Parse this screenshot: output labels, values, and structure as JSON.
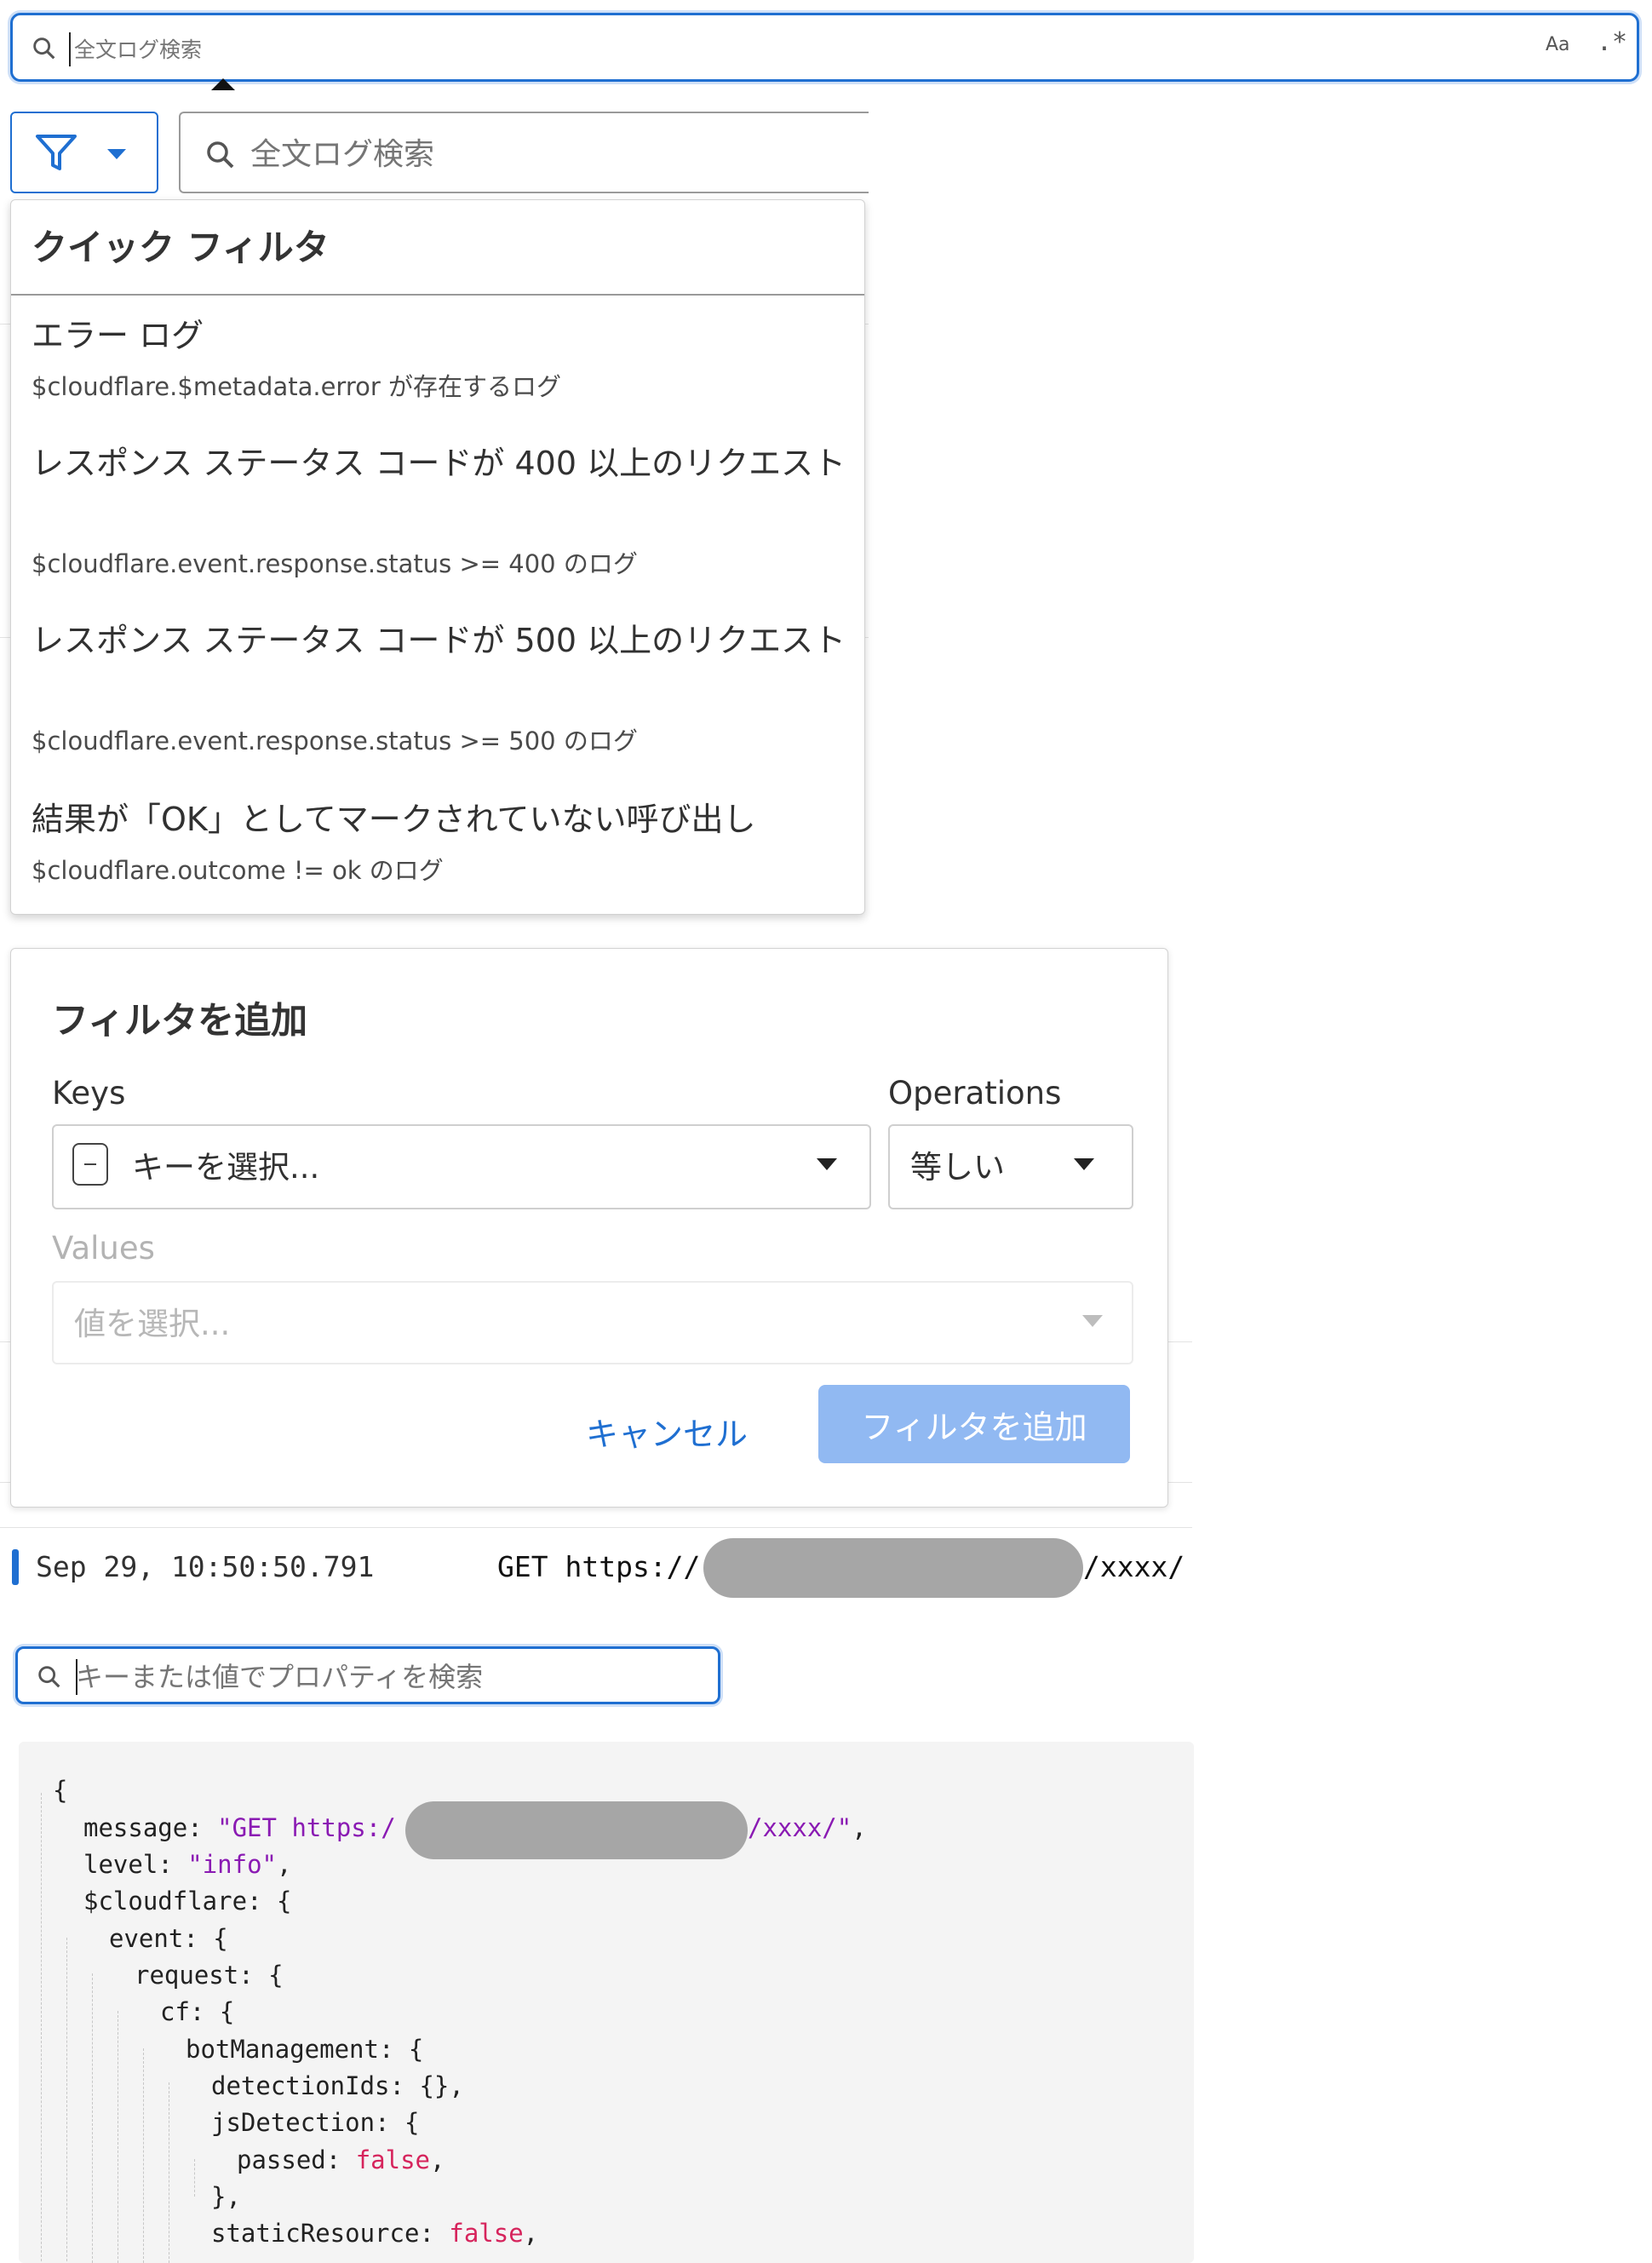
{
  "top_search": {
    "placeholder": "全文ログ検索",
    "case_toggle": "Aa",
    "regex_toggle": ".*"
  },
  "filter_bar": {
    "search_placeholder": "全文ログ検索"
  },
  "quick_filter": {
    "header": "クイック フィルタ",
    "items": [
      {
        "title": "エラー ログ",
        "desc": "$cloudflare.$metadata.error が存在するログ"
      },
      {
        "title": "レスポンス ステータス コードが 400 以上のリクエスト",
        "desc": "$cloudflare.event.response.status >= 400 のログ"
      },
      {
        "title": "レスポンス ステータス コードが 500 以上のリクエスト",
        "desc": "$cloudflare.event.response.status >= 500 のログ"
      },
      {
        "title": "結果が「OK」としてマークされていない呼び出し",
        "desc": "$cloudflare.outcome != ok のログ"
      }
    ]
  },
  "add_filter": {
    "title": "フィルタを追加",
    "keys_label": "Keys",
    "keys_placeholder": "キーを選択...",
    "operations_label": "Operations",
    "operation_value": "等しい",
    "values_label": "Values",
    "values_placeholder": "値を選択...",
    "cancel_label": "キャンセル",
    "submit_label": "フィルタを追加"
  },
  "log_row": {
    "timestamp": "Sep 29, 10:50:50.791",
    "request_prefix": "GET https://",
    "request_suffix": "/xxxx/"
  },
  "property_search": {
    "placeholder": "キーまたは値でプロパティを検索"
  },
  "json_view": {
    "open": "{",
    "message_key": "message",
    "message_prefix": "\"GET https:/",
    "message_suffix": "/xxxx/\"",
    "level_key": "level",
    "level_value": "\"info\"",
    "cloudflare_key": "$cloudflare",
    "event_key": "event",
    "request_key": "request",
    "cf_key": "cf",
    "bot_key": "botManagement",
    "detection_key": "detectionIds",
    "detection_value": "{}",
    "js_key": "jsDetection",
    "passed_key": "passed",
    "passed_value": "false",
    "close_inner": "},",
    "static_key": "staticResource",
    "static_value": "false"
  },
  "colors": {
    "accent": "#1f6fd1",
    "json_string": "#8a1ab3",
    "json_boolean": "#d6245c",
    "redaction": "#a6a6a6"
  }
}
